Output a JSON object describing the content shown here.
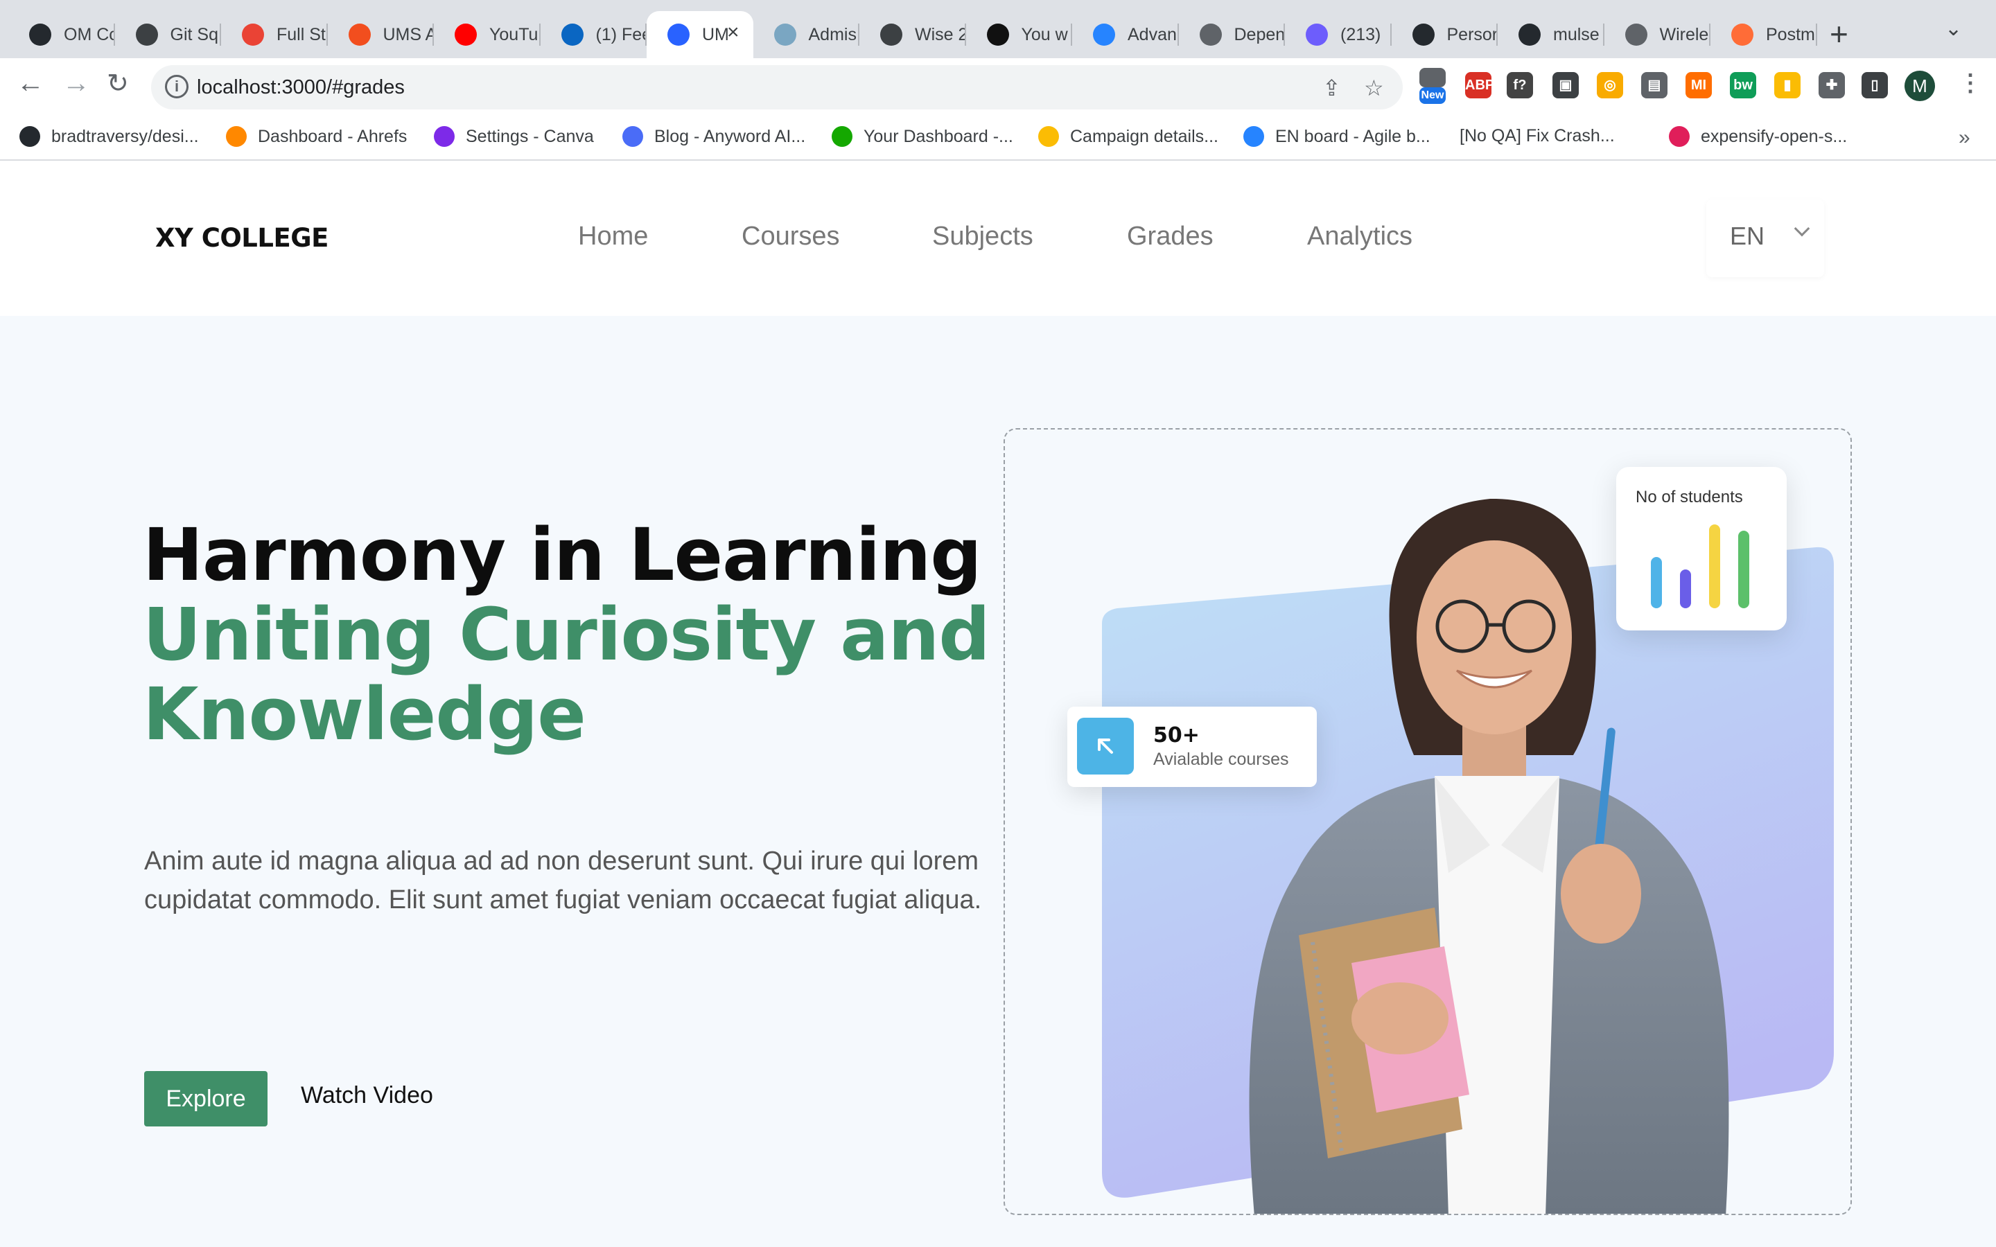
{
  "browser": {
    "tabs": [
      {
        "title": "OM Cc",
        "fav": "#24292e"
      },
      {
        "title": "Git Sq",
        "fav": "#3c4043"
      },
      {
        "title": "Full St",
        "fav": "#ea4335"
      },
      {
        "title": "UMS A",
        "fav": "#f24e1e"
      },
      {
        "title": "YouTul",
        "fav": "#ff0000"
      },
      {
        "title": "(1) Fee",
        "fav": "#0a66c2"
      },
      {
        "title": "UM",
        "fav": "#2962ff",
        "active": true
      },
      {
        "title": "Admis",
        "fav": "#7aa6c2"
      },
      {
        "title": "Wise 2",
        "fav": "#3c4043"
      },
      {
        "title": "You w",
        "fav": "#111111"
      },
      {
        "title": "Advan",
        "fav": "#2684ff"
      },
      {
        "title": "Depen",
        "fav": "#5f6368"
      },
      {
        "title": "(213)",
        "fav": "#6d5dfc"
      },
      {
        "title": "Persor",
        "fav": "#24292e"
      },
      {
        "title": "mulse",
        "fav": "#24292e"
      },
      {
        "title": "Wirele",
        "fav": "#5f6368"
      },
      {
        "title": "Postm",
        "fav": "#ff6c37"
      }
    ],
    "url": "localhost:3000/#grades",
    "profile_initial": "M",
    "ext_new_badge": "New",
    "extensions": [
      {
        "label": "ABP",
        "color": "#d93025"
      },
      {
        "label": "f?",
        "color": "#444444"
      },
      {
        "label": "▣",
        "color": "#3c4043"
      },
      {
        "label": "◎",
        "color": "#f9ab00"
      },
      {
        "label": "▤",
        "color": "#5f6368"
      },
      {
        "label": "MI",
        "color": "#ff6d00"
      },
      {
        "label": "bw",
        "color": "#0f9d58"
      },
      {
        "label": "▮",
        "color": "#fbbc04"
      },
      {
        "label": "✚",
        "color": "#5f6368"
      },
      {
        "label": "▯",
        "color": "#3c4043"
      }
    ],
    "bookmarks": [
      {
        "label": "bradtraversy/desi...",
        "fav": "#24292e"
      },
      {
        "label": "Dashboard - Ahrefs",
        "fav": "#ff8800"
      },
      {
        "label": "Settings - Canva",
        "fav": "#7d2ae8"
      },
      {
        "label": "Blog - Anyword AI...",
        "fav": "#4a6cf7"
      },
      {
        "label": "Your Dashboard -...",
        "fav": "#14a800"
      },
      {
        "label": "Campaign details...",
        "fav": "#fbbc04"
      },
      {
        "label": "EN board - Agile b...",
        "fav": "#2684ff"
      },
      {
        "label": "[No QA] Fix Crash...",
        "fav": ""
      },
      {
        "label": "expensify-open-s...",
        "fav": "#e01e5a"
      }
    ]
  },
  "site": {
    "logo": "XY COLLEGE",
    "nav": [
      "Home",
      "Courses",
      "Subjects",
      "Grades",
      "Analytics"
    ],
    "language": "EN"
  },
  "hero": {
    "title_line1": "Harmony in Learning",
    "title_line2": "Uniting Curiosity and",
    "title_line3": "Knowledge",
    "description": "Anim aute id magna aliqua ad ad non deserunt sunt. Qui irure qui lorem cupidatat commodo. Elit sunt amet fugiat veniam occaecat fugiat aliqua.",
    "explore_label": "Explore",
    "watch_label": "Watch Video"
  },
  "visual": {
    "stats_label": "No of students",
    "stats_bars": [
      {
        "level": 0.57,
        "color": "#4fb3e8"
      },
      {
        "level": 0.43,
        "color": "#6a5ee8"
      },
      {
        "level": 0.93,
        "color": "#f5d442"
      },
      {
        "level": 0.86,
        "color": "#5cc06a"
      }
    ],
    "courses_count": "50+",
    "courses_label": "Avialable courses",
    "accent_color": "#3f8f68"
  }
}
